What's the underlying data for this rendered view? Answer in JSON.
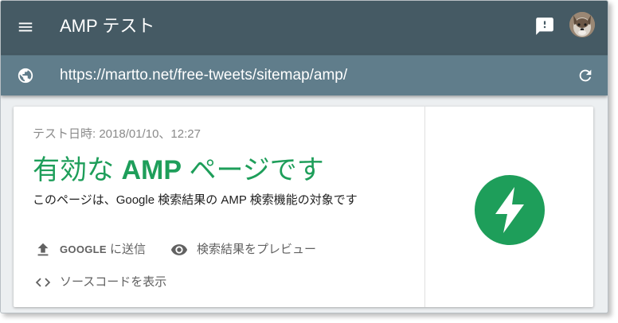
{
  "app": {
    "title": "AMP テスト"
  },
  "url_bar": {
    "url": "https://martto.net/free-tweets/sitemap/amp/"
  },
  "result": {
    "test_time": "テスト日時: 2018/01/10、12:27",
    "title_prefix": "有効な ",
    "title_bold": "AMP",
    "title_suffix": " ページです",
    "description": "このページは、Google 検索結果の AMP 検索機能の対象です"
  },
  "actions": {
    "submit_caps": "GOOGLE",
    "submit_rest": " に送信",
    "preview": "検索結果をプレビュー",
    "view_source": "ソースコードを表示"
  },
  "icons": {
    "menu": "hamburger-menu-icon",
    "feedback": "feedback-icon",
    "globe": "globe-icon",
    "refresh": "refresh-icon",
    "upload": "upload-icon",
    "eye": "eye-icon",
    "code": "code-icon",
    "amp": "amp-lightning-logo"
  },
  "colors": {
    "appbar": "#455a64",
    "urlbar": "#607d8b",
    "valid_green": "#1e9e5a"
  }
}
